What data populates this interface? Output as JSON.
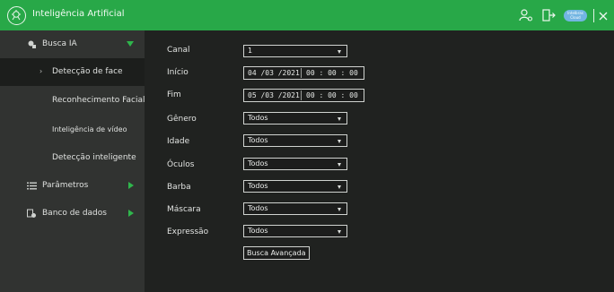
{
  "app": {
    "title": "Inteligência Artificial",
    "cloud_badge": "Intelbras Cloud"
  },
  "colors": {
    "accent": "#28a848",
    "sidebar_bg": "#313331",
    "active_bg": "#1c1e1c",
    "main_bg": "#202220",
    "arrow": "#2fb64c",
    "cloud": "#72b5e2"
  },
  "sidebar": {
    "busca_ia": "Busca IA",
    "deteccao_face": "Detecção de face",
    "reconhecimento": "Reconhecimento Facial",
    "inteligencia_video": "Inteligência de vídeo",
    "deteccao_inteligente": "Detecção inteligente",
    "parametros": "Parâmetros",
    "banco_dados": "Banco de dados"
  },
  "form": {
    "canal": {
      "label": "Canal",
      "value": "1"
    },
    "inicio": {
      "label": "Início",
      "date": "04 /03 /2021",
      "time": "00 : 00 : 00"
    },
    "fim": {
      "label": "Fim",
      "date": "05 /03 /2021",
      "time": "00 : 00 : 00"
    },
    "genero": {
      "label": "Gênero",
      "value": "Todos"
    },
    "idade": {
      "label": "Idade",
      "value": "Todos"
    },
    "oculos": {
      "label": "Óculos",
      "value": "Todos"
    },
    "barba": {
      "label": "Barba",
      "value": "Todos"
    },
    "mascara": {
      "label": "Máscara",
      "value": "Todos"
    },
    "expressao": {
      "label": "Expressão",
      "value": "Todos"
    },
    "advanced_search": "Busca Avançada"
  }
}
